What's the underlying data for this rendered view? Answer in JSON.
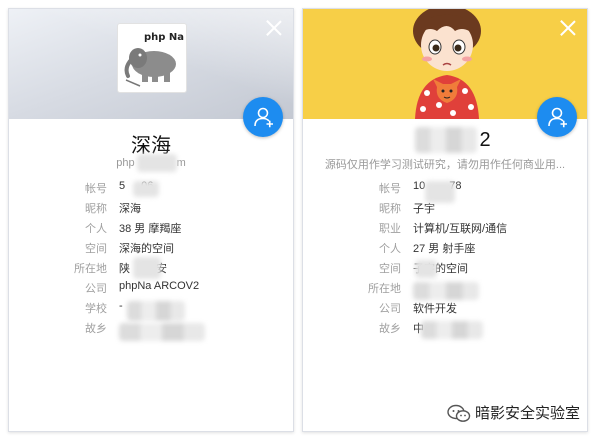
{
  "card_left": {
    "name": "深海",
    "sub_start": "php",
    "sub_end": "m",
    "logo_text": "php Na",
    "fields": [
      {
        "label": "帐号",
        "value_start": "5",
        "value_end": "06"
      },
      {
        "label": "昵称",
        "value": "深海"
      },
      {
        "label": "个人",
        "value": "38 男 摩羯座"
      },
      {
        "label": "空间",
        "value": "深海的空间"
      },
      {
        "label": "所在地",
        "value_start": "陕",
        "value_end": "安"
      },
      {
        "label": "公司",
        "value": "phpNa ARCOV2"
      },
      {
        "label": "学校",
        "value": "-"
      },
      {
        "label": "故乡",
        "value": ""
      }
    ]
  },
  "card_right": {
    "name_end": "2",
    "subtitle": "源码仅用作学习测试研究，请勿用作任何商业用...",
    "fields": [
      {
        "label": "帐号",
        "value_start": "10",
        "value_end": "78"
      },
      {
        "label": "昵称",
        "value": "子宇"
      },
      {
        "label": "职业",
        "value": "计算机/互联网/通信"
      },
      {
        "label": "个人",
        "value": "27 男 射手座"
      },
      {
        "label": "空间",
        "value": "子宇的空间"
      },
      {
        "label": "所在地",
        "value": ""
      },
      {
        "label": "公司",
        "value": "软件开发"
      },
      {
        "label": "故乡",
        "value": "中"
      }
    ]
  },
  "watermark": "暗影安全实验室",
  "colors": {
    "accent": "#1d8cf0",
    "banner_yellow": "#f7cf47"
  },
  "icons": [
    "close-icon",
    "add-friend-icon",
    "elephant-logo",
    "wechat-icon"
  ]
}
